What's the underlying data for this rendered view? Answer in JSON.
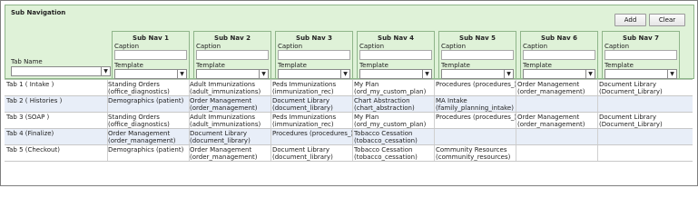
{
  "panel": {
    "title": "Sub Navigation",
    "add_label": "Add",
    "clear_label": "Clear",
    "tab_name_label": "Tab Name",
    "caption_label": "Caption",
    "template_label": "Template"
  },
  "nav_columns": [
    {
      "header": "Sub Nav 1"
    },
    {
      "header": "Sub Nav 2"
    },
    {
      "header": "Sub Nav 3"
    },
    {
      "header": "Sub Nav 4"
    },
    {
      "header": "Sub Nav 5"
    },
    {
      "header": "Sub Nav 6"
    },
    {
      "header": "Sub Nav 7"
    }
  ],
  "rows": [
    {
      "tab": "Tab 1 ( Intake )",
      "cells": [
        [
          "Standing Orders",
          "(office_diagnostics)"
        ],
        [
          "Adult Immunizations",
          "(adult_immunizations)"
        ],
        [
          "Peds Immunizations",
          "(immunization_rec)"
        ],
        [
          "My Plan",
          "(ord_my_custom_plan)"
        ],
        [
          "Procedures (procedures_)",
          ""
        ],
        [
          "Order Management",
          "(order_management)"
        ],
        [
          "Document Library",
          "(Document_Library)"
        ]
      ]
    },
    {
      "tab": "Tab 2 ( Histories )",
      "cells": [
        [
          "Demographics (patient)",
          ""
        ],
        [
          "Order Management",
          "(order_management)"
        ],
        [
          "Document Library",
          "(document_library)"
        ],
        [
          "Chart Abstraction",
          "(chart_abstraction)"
        ],
        [
          "MA Intake",
          "(family_planning_intake)"
        ],
        [
          "",
          ""
        ],
        [
          "",
          ""
        ]
      ]
    },
    {
      "tab": "Tab 3 (SOAP )",
      "cells": [
        [
          "Standing Orders",
          "(office_diagnostics)"
        ],
        [
          "Adult Immunizations",
          "(adult_immunizations)"
        ],
        [
          "Peds Immunizations",
          "(immunization_rec)"
        ],
        [
          "My Plan",
          "(ord_my_custom_plan)"
        ],
        [
          "Procedures (procedures_)",
          ""
        ],
        [
          "Order Management",
          "(order_management)"
        ],
        [
          "Document Library",
          "(Document_Library)"
        ]
      ]
    },
    {
      "tab": "Tab 4 (Finalize)",
      "cells": [
        [
          "Order Management",
          "(order_management)"
        ],
        [
          "Document Library",
          "(document_library)"
        ],
        [
          "Procedures (procedures_)",
          ""
        ],
        [
          "Tobacco Cessation",
          "(tobacco_cessation)"
        ],
        [
          "",
          ""
        ],
        [
          "",
          ""
        ],
        [
          "",
          ""
        ]
      ]
    },
    {
      "tab": "Tab 5 (Checkout)",
      "cells": [
        [
          "Demographics (patient)",
          ""
        ],
        [
          "Order Management",
          "(order_management)"
        ],
        [
          "Document Library",
          "(document_library)"
        ],
        [
          "Tobacco Cessation",
          "(tobacco_cessation)"
        ],
        [
          "Community Resources",
          "(community_resources)"
        ],
        [
          "",
          ""
        ],
        [
          "",
          ""
        ]
      ]
    }
  ],
  "colors": {
    "panel_bg": "#dff2d8",
    "alt_row": "#e8eef8"
  }
}
